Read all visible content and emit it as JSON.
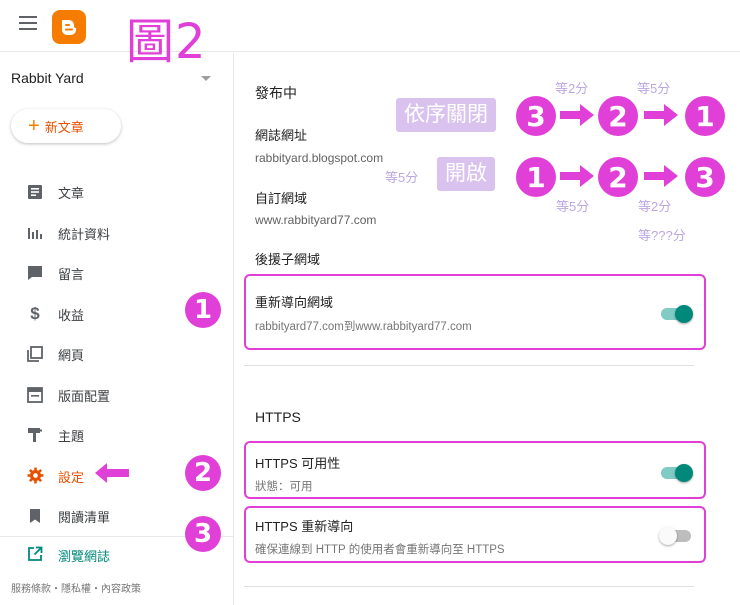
{
  "figure_label": "圖2",
  "header": {
    "menu_icon": "hamburger-menu-icon",
    "logo_icon": "blogger-logo-icon"
  },
  "sidebar": {
    "blog_name": "Rabbit Yard",
    "new_post_label": "新文章",
    "items": [
      {
        "label": "文章",
        "icon": "posts-icon"
      },
      {
        "label": "統計資料",
        "icon": "stats-icon"
      },
      {
        "label": "留言",
        "icon": "comments-icon"
      },
      {
        "label": "收益",
        "icon": "dollar-icon"
      },
      {
        "label": "網頁",
        "icon": "pages-icon"
      },
      {
        "label": "版面配置",
        "icon": "layout-icon"
      },
      {
        "label": "主題",
        "icon": "theme-icon"
      },
      {
        "label": "設定",
        "icon": "gear-icon",
        "active": true
      },
      {
        "label": "閱讀清單",
        "icon": "bookmark-icon"
      }
    ],
    "view_blog_label": "瀏覽網誌",
    "footer": "服務條款・隱私權・內容政策"
  },
  "main": {
    "publishing_title": "發布中",
    "blog_address_label": "網誌網址",
    "blog_address_value": "rabbityard.blogspot.com",
    "custom_domain_label": "自訂網域",
    "custom_domain_value": "www.rabbityard77.com",
    "fallback_label": "後援子網域",
    "redirect_title": "重新導向網域",
    "redirect_sub": "rabbityard77.com到www.rabbityard77.com",
    "redirect_enabled": true,
    "https_title": "HTTPS",
    "https_availability_title": "HTTPS 可用性",
    "https_availability_sub": "狀態：可用",
    "https_availability_enabled": true,
    "https_redirect_title": "HTTPS 重新導向",
    "https_redirect_sub": "確保連線到 HTTP 的使用者會重新導向至 HTTPS",
    "https_redirect_enabled": false
  },
  "annotations": {
    "close_tag": "依序關閉",
    "open_tag": "開啟",
    "wait_2": "等2分",
    "wait_5": "等5分",
    "wait_unknown": "等???分",
    "num_1": "1",
    "num_2": "2",
    "num_3": "3",
    "accent_color": "#e040d8",
    "tag_color": "#d9c3ee"
  }
}
